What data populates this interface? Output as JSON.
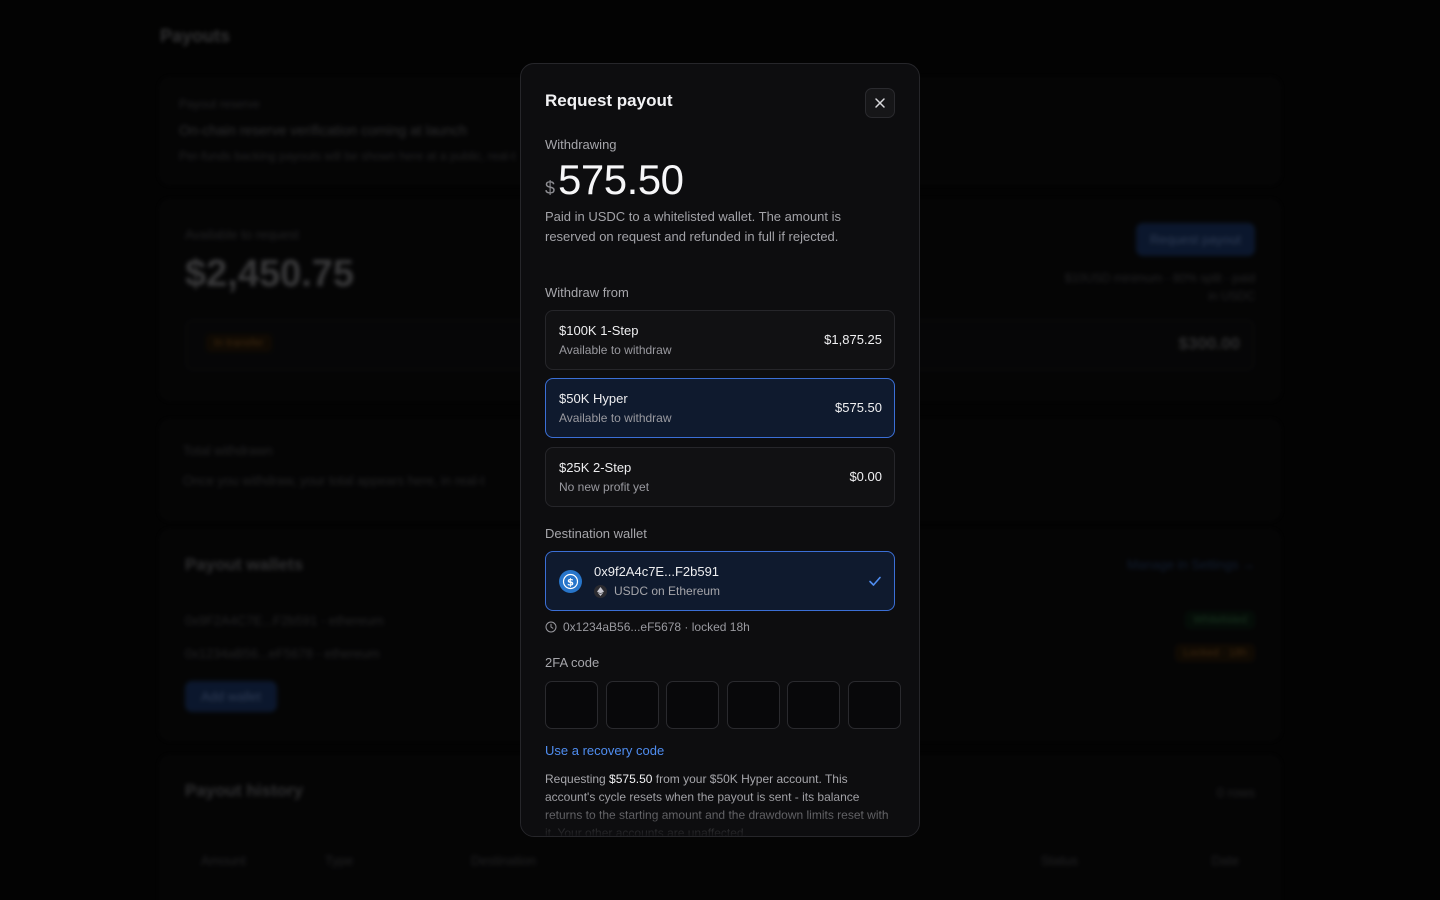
{
  "background": {
    "page_title": "Payouts",
    "reserve": {
      "label": "Payout reserve",
      "headline": "On-chain reserve verification coming at launch",
      "note": "Per-funds backing payouts will be shown here at a public, real-t"
    },
    "available": {
      "label": "Available to request",
      "amount": "$2,450.75",
      "request_button": "Request payout",
      "note_line1": "$10USD minimum · 80% split · paid",
      "note_line2": "in USDC",
      "badge": "In transfer",
      "pending_amount": "$300.00"
    },
    "total": {
      "label": "Total withdrawn",
      "note": "Once you withdraw, your total appears here, in real-t"
    },
    "wallets": {
      "title": "Payout wallets",
      "manage_link": "Manage in Settings →",
      "rows": [
        {
          "address": "0x9F2A4C7E...F2b591 · ethereum",
          "status": "Whitelisted"
        },
        {
          "address": "0x1234aB56...eF5678 · ethereum",
          "status": "Locked · 18h"
        }
      ],
      "add_button": "Add wallet"
    },
    "history": {
      "title": "Payout history",
      "count": "0 rows",
      "columns": [
        "Amount",
        "Type",
        "Destination",
        "Status",
        "Date"
      ]
    }
  },
  "modal": {
    "title": "Request payout",
    "withdrawing_label": "Withdrawing",
    "currency_symbol": "$",
    "amount": "575.50",
    "description": "Paid in USDC to a whitelisted wallet. The amount is reserved on request and refunded in full if rejected.",
    "withdraw_from_label": "Withdraw from",
    "accounts": [
      {
        "name": "$100K 1-Step",
        "sub": "Available to withdraw",
        "amount": "$1,875.25",
        "selected": false
      },
      {
        "name": "$50K Hyper",
        "sub": "Available to withdraw",
        "amount": "$575.50",
        "selected": true
      },
      {
        "name": "$25K 2-Step",
        "sub": "No new profit yet",
        "amount": "$0.00",
        "selected": false
      }
    ],
    "destination_label": "Destination wallet",
    "wallet": {
      "address": "0x9f2A4c7E...F2b591",
      "network": "USDC on Ethereum"
    },
    "locked_wallet": "0x1234aB56...eF5678 · locked 18h",
    "twofa_label": "2FA code",
    "otp_count": 6,
    "recovery_link": "Use a recovery code",
    "summary": {
      "prefix": "Requesting ",
      "amount": "$575.50",
      "suffix": " from your $50K Hyper account. This account's cycle resets when the payout is sent - its balance returns to the starting amount and the drawdown limits reset with it. Your other accounts are unaffected."
    }
  },
  "colors": {
    "accent": "#3b6fd6",
    "link": "#4f8df0",
    "usdc": "#2775ca"
  }
}
